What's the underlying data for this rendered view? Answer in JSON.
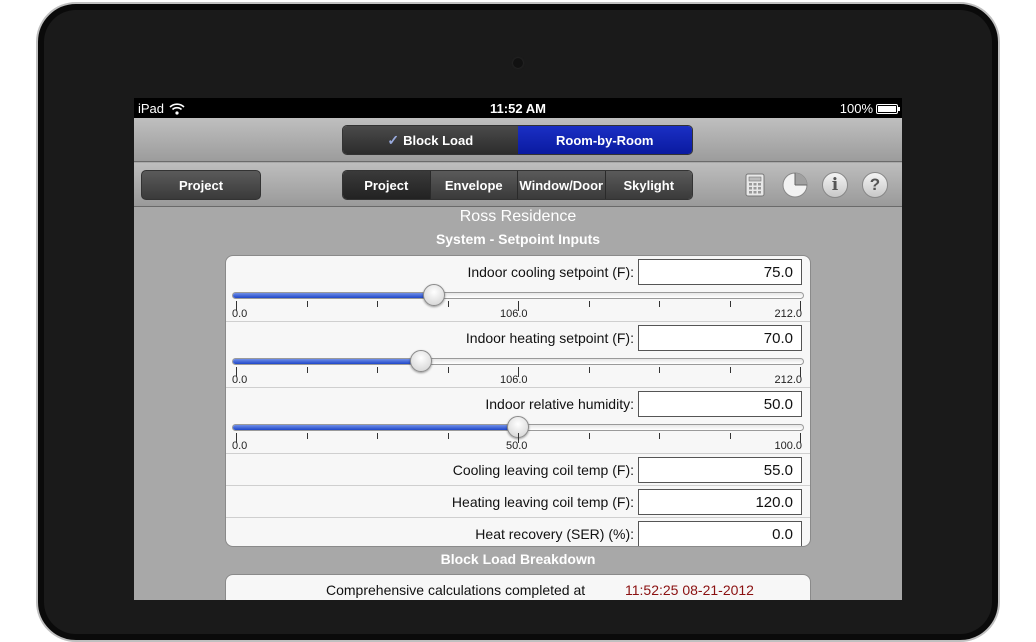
{
  "status": {
    "device": "iPad",
    "time": "11:52 AM",
    "battery": "100%",
    "battery_level": 100
  },
  "mode_tabs": [
    {
      "label": "Block Load",
      "checked": true
    },
    {
      "label": "Room-by-Room",
      "active": true
    }
  ],
  "toolbar": {
    "project_button": "Project",
    "tabs": [
      "Project",
      "Envelope",
      "Window/Door",
      "Skylight"
    ],
    "icons": {
      "info": "i",
      "help": "?"
    }
  },
  "project_name": "Ross Residence",
  "section_title": "System - Setpoint Inputs",
  "inputs": [
    {
      "label": "Indoor cooling setpoint (F):",
      "value": "75.0",
      "slider": {
        "min": "0.0",
        "mid": "106.0",
        "max": "212.0",
        "level": 0.3538
      }
    },
    {
      "label": "Indoor heating setpoint (F):",
      "value": "70.0",
      "slider": {
        "min": "0.0",
        "mid": "106.0",
        "max": "212.0",
        "level": 0.3302
      }
    },
    {
      "label": "Indoor relative humidity:",
      "value": "50.0",
      "slider": {
        "min": "0.0",
        "mid": "50.0",
        "max": "100.0",
        "level": 0.5
      }
    },
    {
      "label": "Cooling leaving coil temp (F):",
      "value": "55.0"
    },
    {
      "label": "Heating leaving coil temp (F):",
      "value": "120.0"
    },
    {
      "label": "Heat recovery (SER) (%):",
      "value": "0.0"
    }
  ],
  "breakdown": {
    "title": "Block Load Breakdown",
    "label": "Comprehensive calculations completed at",
    "timestamp": "11:52:25 08-21-2012"
  },
  "colors": {
    "active_tab": "#0a1aa0",
    "slider_fill": "#1f47c8",
    "timestamp": "#8a1010"
  }
}
